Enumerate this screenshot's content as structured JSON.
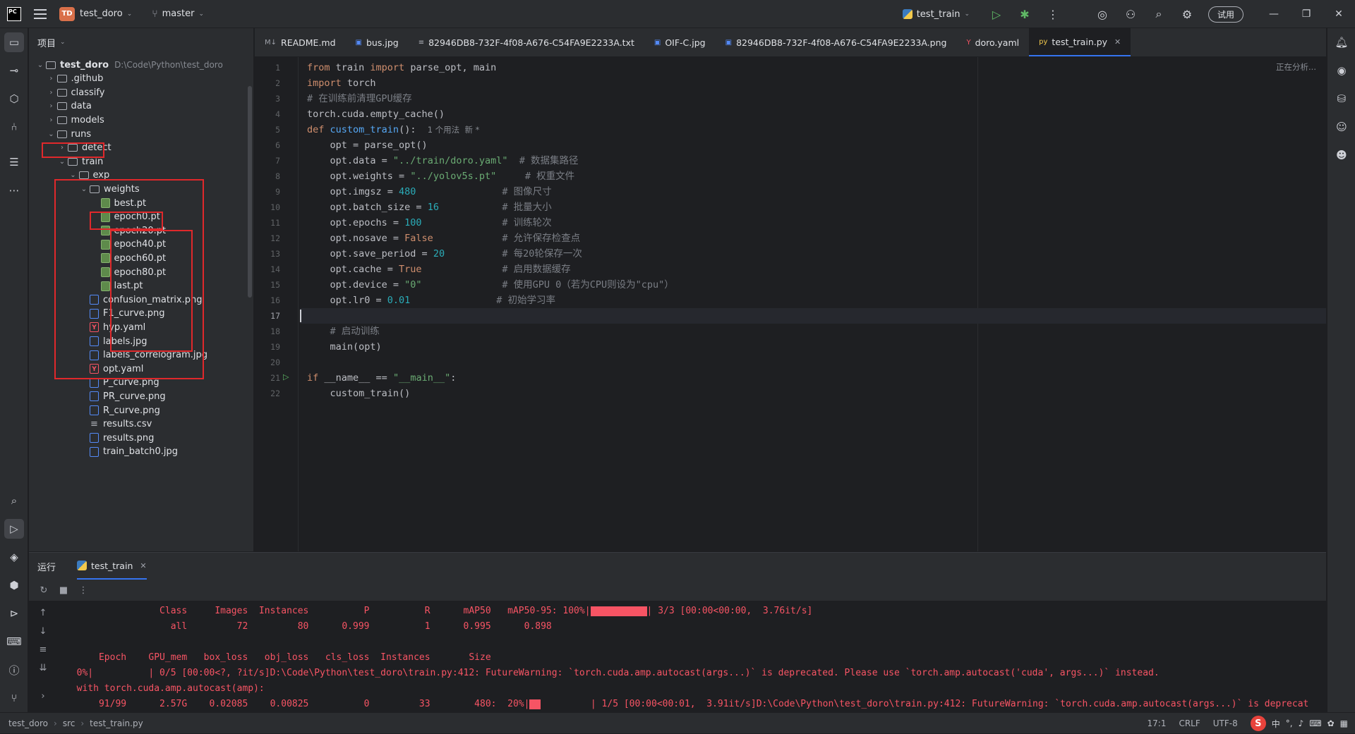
{
  "titlebar": {
    "project_badge": "TD",
    "project_name": "test_doro",
    "branch": "master",
    "run_config": "test_train",
    "trial_label": "试用"
  },
  "project_panel": {
    "title": "项目",
    "root_name": "test_doro",
    "root_path": "D:\\Code\\Python\\test_doro",
    "items": [
      {
        "label": ".github",
        "kind": "folder",
        "depth": 1,
        "arrow": "›"
      },
      {
        "label": "classify",
        "kind": "folder",
        "depth": 1,
        "arrow": "›"
      },
      {
        "label": "data",
        "kind": "folder",
        "depth": 1,
        "arrow": "›"
      },
      {
        "label": "models",
        "kind": "folder",
        "depth": 1,
        "arrow": "›"
      },
      {
        "label": "runs",
        "kind": "folder",
        "depth": 1,
        "arrow": "⌄"
      },
      {
        "label": "detect",
        "kind": "folder",
        "depth": 2,
        "arrow": "›"
      },
      {
        "label": "train",
        "kind": "folder",
        "depth": 2,
        "arrow": "⌄"
      },
      {
        "label": "exp",
        "kind": "folder",
        "depth": 3,
        "arrow": "⌄"
      },
      {
        "label": "weights",
        "kind": "folder",
        "depth": 4,
        "arrow": "⌄"
      },
      {
        "label": "best.pt",
        "kind": "pt",
        "depth": 5
      },
      {
        "label": "epoch0.pt",
        "kind": "pt",
        "depth": 5
      },
      {
        "label": "epoch20.pt",
        "kind": "pt",
        "depth": 5
      },
      {
        "label": "epoch40.pt",
        "kind": "pt",
        "depth": 5
      },
      {
        "label": "epoch60.pt",
        "kind": "pt",
        "depth": 5
      },
      {
        "label": "epoch80.pt",
        "kind": "pt",
        "depth": 5
      },
      {
        "label": "last.pt",
        "kind": "pt",
        "depth": 5
      },
      {
        "label": "confusion_matrix.png",
        "kind": "img",
        "depth": 4
      },
      {
        "label": "F1_curve.png",
        "kind": "img",
        "depth": 4
      },
      {
        "label": "hyp.yaml",
        "kind": "yaml",
        "depth": 4
      },
      {
        "label": "labels.jpg",
        "kind": "img",
        "depth": 4
      },
      {
        "label": "labels_correlogram.jpg",
        "kind": "img",
        "depth": 4
      },
      {
        "label": "opt.yaml",
        "kind": "yaml",
        "depth": 4
      },
      {
        "label": "P_curve.png",
        "kind": "img",
        "depth": 4
      },
      {
        "label": "PR_curve.png",
        "kind": "img",
        "depth": 4
      },
      {
        "label": "R_curve.png",
        "kind": "img",
        "depth": 4
      },
      {
        "label": "results.csv",
        "kind": "csv",
        "depth": 4
      },
      {
        "label": "results.png",
        "kind": "img",
        "depth": 4
      },
      {
        "label": "train_batch0.jpg",
        "kind": "img",
        "depth": 4
      }
    ]
  },
  "tabs": [
    {
      "label": "README.md",
      "icon": "M↓",
      "color": "#9da0a8"
    },
    {
      "label": "bus.jpg",
      "icon": "▣",
      "color": "#548af7"
    },
    {
      "label": "82946DB8-732F-4f08-A676-C54FA9E2233A.txt",
      "icon": "≡",
      "color": "#aeb1b8"
    },
    {
      "label": "OIF-C.jpg",
      "icon": "▣",
      "color": "#548af7"
    },
    {
      "label": "82946DB8-732F-4f08-A676-C54FA9E2233A.png",
      "icon": "▣",
      "color": "#548af7"
    },
    {
      "label": "doro.yaml",
      "icon": "Y",
      "color": "#f75464"
    },
    {
      "label": "test_train.py",
      "icon": "py",
      "color": "#f2c94c",
      "active": true
    }
  ],
  "editor": {
    "status": "正在分析...",
    "current_line": 17,
    "run_gutter_line": 21,
    "lines": [
      [
        {
          "t": "from ",
          "c": "kw"
        },
        {
          "t": "train ",
          "c": ""
        },
        {
          "t": "import ",
          "c": "kw"
        },
        {
          "t": "parse_opt, main",
          "c": ""
        }
      ],
      [
        {
          "t": "import ",
          "c": "kw"
        },
        {
          "t": "torch",
          "c": ""
        }
      ],
      [
        {
          "t": "# 在训练前清理GPU缓存",
          "c": "cmt"
        }
      ],
      [
        {
          "t": "torch.cuda.empty_cache()",
          "c": ""
        }
      ],
      [
        {
          "t": "def ",
          "c": "kw"
        },
        {
          "t": "custom_train",
          "c": "fn"
        },
        {
          "t": "():  ",
          "c": ""
        },
        {
          "t": "1 个用法  新 *",
          "c": "hint"
        }
      ],
      [
        {
          "t": "    opt = parse_opt()",
          "c": ""
        }
      ],
      [
        {
          "t": "    opt.data = ",
          "c": ""
        },
        {
          "t": "\"../train/doro.yaml\"",
          "c": "str"
        },
        {
          "t": "  ",
          "c": ""
        },
        {
          "t": "# 数据集路径",
          "c": "cmt"
        }
      ],
      [
        {
          "t": "    opt.weights = ",
          "c": ""
        },
        {
          "t": "\"../yolov5s.pt\"",
          "c": "str"
        },
        {
          "t": "     ",
          "c": ""
        },
        {
          "t": "# 权重文件",
          "c": "cmt"
        }
      ],
      [
        {
          "t": "    opt.imgsz = ",
          "c": ""
        },
        {
          "t": "480",
          "c": "num"
        },
        {
          "t": "               ",
          "c": ""
        },
        {
          "t": "# 图像尺寸",
          "c": "cmt"
        }
      ],
      [
        {
          "t": "    opt.batch_size = ",
          "c": ""
        },
        {
          "t": "16",
          "c": "num"
        },
        {
          "t": "           ",
          "c": ""
        },
        {
          "t": "# 批量大小",
          "c": "cmt"
        }
      ],
      [
        {
          "t": "    opt.epochs = ",
          "c": ""
        },
        {
          "t": "100",
          "c": "num"
        },
        {
          "t": "              ",
          "c": ""
        },
        {
          "t": "# 训练轮次",
          "c": "cmt"
        }
      ],
      [
        {
          "t": "    opt.nosave = ",
          "c": ""
        },
        {
          "t": "False",
          "c": "kw"
        },
        {
          "t": "            ",
          "c": ""
        },
        {
          "t": "# 允许保存检查点",
          "c": "cmt"
        }
      ],
      [
        {
          "t": "    opt.save_period = ",
          "c": ""
        },
        {
          "t": "20",
          "c": "num"
        },
        {
          "t": "          ",
          "c": ""
        },
        {
          "t": "# 每20轮保存一次",
          "c": "cmt"
        }
      ],
      [
        {
          "t": "    opt.cache = ",
          "c": ""
        },
        {
          "t": "True",
          "c": "kw"
        },
        {
          "t": "              ",
          "c": ""
        },
        {
          "t": "# 启用数据缓存",
          "c": "cmt"
        }
      ],
      [
        {
          "t": "    opt.device = ",
          "c": ""
        },
        {
          "t": "\"0\"",
          "c": "str"
        },
        {
          "t": "              ",
          "c": ""
        },
        {
          "t": "# 使用GPU 0（若为CPU则设为\"cpu\"）",
          "c": "cmt"
        }
      ],
      [
        {
          "t": "    opt.lr0 = ",
          "c": ""
        },
        {
          "t": "0.01",
          "c": "num"
        },
        {
          "t": "               ",
          "c": ""
        },
        {
          "t": "# 初始学习率",
          "c": "cmt"
        }
      ],
      [
        {
          "t": "",
          "c": ""
        }
      ],
      [
        {
          "t": "    ",
          "c": ""
        },
        {
          "t": "# 启动训练",
          "c": "cmt"
        }
      ],
      [
        {
          "t": "    main(opt)",
          "c": ""
        }
      ],
      [
        {
          "t": "",
          "c": ""
        }
      ],
      [
        {
          "t": "if ",
          "c": "kw"
        },
        {
          "t": "__name__ == ",
          "c": ""
        },
        {
          "t": "\"__main__\"",
          "c": "str"
        },
        {
          "t": ":",
          "c": ""
        }
      ],
      [
        {
          "t": "    custom_train()",
          "c": ""
        }
      ]
    ]
  },
  "run_panel": {
    "title": "运行",
    "tab_label": "test_train",
    "console": [
      {
        "text": "                 Class     Images  Instances          P          R      mAP50   mAP50-95: 100%|",
        "bar": 80,
        "tail": "| 3/3 [00:00<00:00,  3.76it/s]"
      },
      {
        "text": "                   all         72         80      0.999          1      0.995      0.898"
      },
      {
        "text": ""
      },
      {
        "text": "      Epoch    GPU_mem   box_loss   obj_loss   cls_loss  Instances       Size"
      },
      {
        "text": "  0%|          | 0/5 [00:00<?, ?it/s]D:\\Code\\Python\\test_doro\\train.py:412: FutureWarning: `torch.cuda.amp.autocast(args...)` is deprecated. Please use `torch.amp.autocast('cuda', args...)` instead."
      },
      {
        "text": "  with torch.cuda.amp.autocast(amp):"
      },
      {
        "text": "      91/99      2.57G    0.02085    0.00825          0         33        480:  20%|",
        "bar": 16,
        "tail": "         | 1/5 [00:00<00:01,  3.91it/s]D:\\Code\\Python\\test_doro\\train.py:412: FutureWarning: `torch.cuda.amp.autocast(args...)` is deprecat"
      }
    ]
  },
  "statusbar": {
    "crumbs": [
      "test_doro",
      "src",
      "test_train.py"
    ],
    "position": "17:1",
    "line_sep": "CRLF",
    "encoding": "UTF-8",
    "ime_logo": "S",
    "ime_lang": "中"
  }
}
